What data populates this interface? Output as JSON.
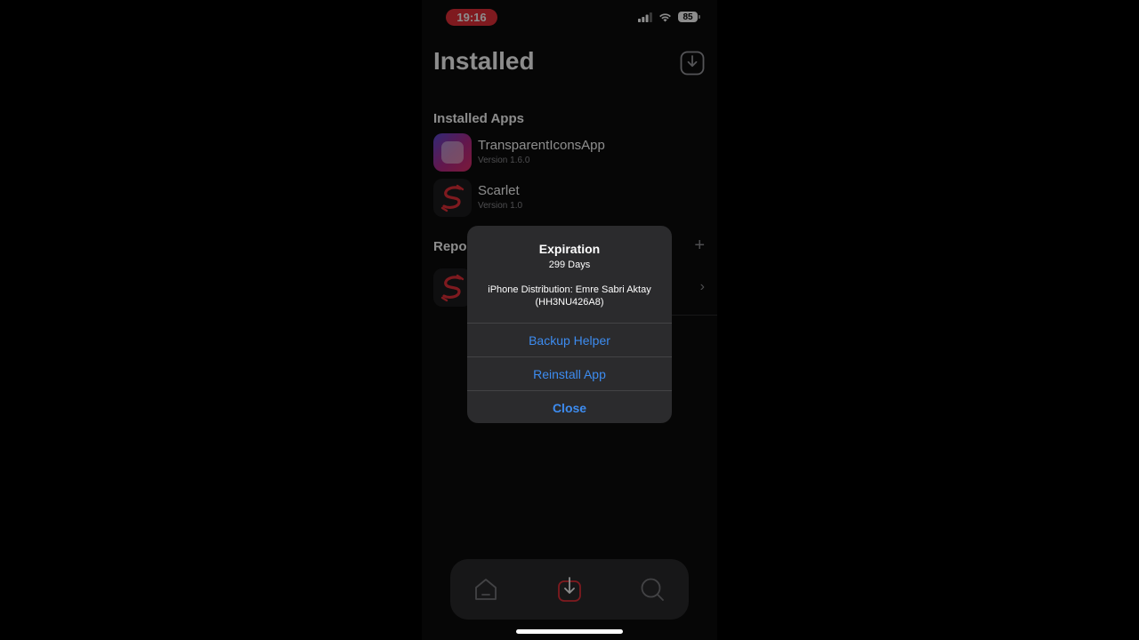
{
  "status_bar": {
    "time": "19:16",
    "battery": "85"
  },
  "header": {
    "title": "Installed"
  },
  "sections": {
    "installed_apps_title": "Installed Apps",
    "repos_title_visible": "Repo"
  },
  "installed_apps": [
    {
      "name": "TransparentIconsApp",
      "version": "Version 1.6.0"
    },
    {
      "name": "Scarlet",
      "version": "Version 1.0"
    }
  ],
  "alert": {
    "title": "Expiration",
    "days": "299 Days",
    "certificate_line1": "iPhone Distribution: Emre Sabri Aktay",
    "certificate_line2": "(HH3NU426A8)",
    "buttons": {
      "backup": "Backup Helper",
      "reinstall": "Reinstall App",
      "close": "Close"
    }
  },
  "colors": {
    "accent_red": "#e8303a",
    "alert_button_blue": "#3d8cf0"
  },
  "icons": {
    "header": "download-icon",
    "tab_home": "home-icon",
    "tab_installed": "download-icon",
    "tab_search": "search-icon"
  }
}
